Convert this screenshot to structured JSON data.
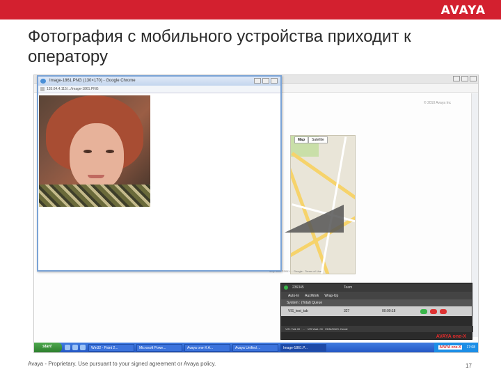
{
  "slide": {
    "logo": "AVAYA",
    "title": "Фотография с мобильного устройства приходит к оператору",
    "footer": "Avaya - Proprietary. Use pursuant to your signed agreement or Avaya policy.",
    "page_number": "17"
  },
  "screenshot": {
    "popup": {
      "title": "Image-1861.PNG (130×170) - Google Chrome",
      "address": "135.64.4.115/.../Image-1861.PNG"
    },
    "background_copyright": "© 2010 Avaya Inc",
    "map": {
      "tabs": [
        "Map",
        "Satellite"
      ],
      "credit": "Map data ©2011 ... Google · Terms of Use"
    },
    "softphone": {
      "number": "236345",
      "status": "Team",
      "tabs": [
        "Auto-In",
        "AuxWork",
        "Wrap-Up"
      ],
      "group": "System : (Total) Queue",
      "call_name": "VIS_test_tab",
      "call_ext": "327",
      "call_time": "00:00:18",
      "footer": "VIS: Talk 00 · ... · VIS Wait: 00 · EDM/DNIS: Detail",
      "brand": "AVAYA one-X"
    },
    "taskbar": {
      "start": "start",
      "items": [
        {
          "label": "Win32 - Paint 2...",
          "active": false
        },
        {
          "label": "Microsoft Powe...",
          "active": false
        },
        {
          "label": "Avaya one-X A...",
          "active": false
        },
        {
          "label": "Avaya Unified ...",
          "active": false
        },
        {
          "label": "Image-1861.P...",
          "active": true
        }
      ],
      "tray_brand": "AVAYA one-X",
      "clock": "17:08"
    }
  }
}
